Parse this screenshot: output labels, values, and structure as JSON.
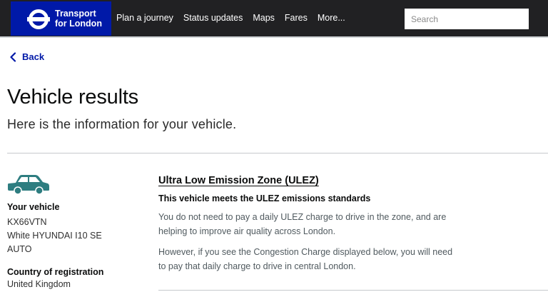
{
  "header": {
    "logo_line1": "Transport",
    "logo_line2": "for London",
    "nav": [
      "Plan a journey",
      "Status updates",
      "Maps",
      "Fares",
      "More..."
    ],
    "search_placeholder": "Search"
  },
  "back_label": "Back",
  "page_title": "Vehicle results",
  "subtitle": "Here is the information for your vehicle.",
  "vehicle": {
    "heading": "Your vehicle",
    "registration": "KX66VTN",
    "description_line1": "White HYUNDAI I10 SE",
    "description_line2": "AUTO",
    "country_heading": "Country of registration",
    "country": "United Kingdom",
    "icon_color": "#2e7d80"
  },
  "ulez": {
    "title": "Ultra Low Emission Zone (ULEZ)",
    "status": "This vehicle meets the ULEZ emissions standards",
    "para1_line1": "You do not need to pay a daily ULEZ charge to drive in the zone, and are",
    "para1_line2": "helping to improve air quality across London.",
    "para2_line1": "However, if you see the Congestion Charge displayed below, you will need",
    "para2_line2": "to pay that daily charge to drive in central London."
  },
  "colors": {
    "header_bg": "#212123",
    "brand_blue": "#0019a8"
  }
}
